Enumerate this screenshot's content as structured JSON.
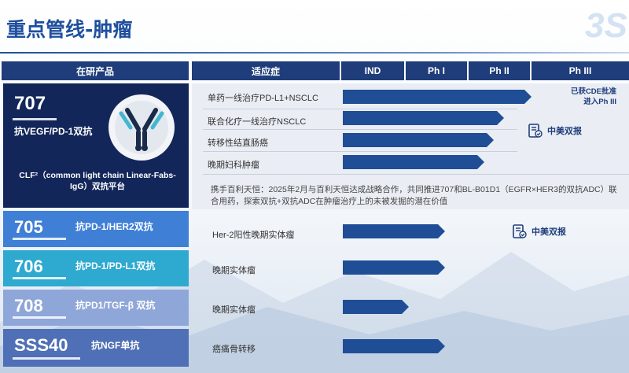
{
  "page": {
    "title": "重点管线-肿瘤",
    "logo_text": "3S"
  },
  "header": {
    "product": "在研产品",
    "indication": "适应症",
    "ind": "IND",
    "ph1": "Ph I",
    "ph2": "Ph II",
    "ph3": "Ph III"
  },
  "products": [
    {
      "code": "707",
      "desc": "抗VEGF/PD-1双抗",
      "platform": "CLF²（common light chain Linear-Fabs-IgG）双抗平台",
      "color": "#12265a",
      "indications": [
        {
          "name": "单药一线治疗PD-L1+NSCLC",
          "progress_to": "Ph III"
        },
        {
          "name": "联合化疗一线治疗NSCLC",
          "progress_to": "Ph II"
        },
        {
          "name": "转移性结直肠癌",
          "progress_to": "Ph II"
        },
        {
          "name": "晚期妇科肿瘤",
          "progress_to": "Ph II"
        }
      ],
      "cde_note_line1": "已获CDE批准",
      "cde_note_line2": "进入Ph III",
      "report_label": "中美双报",
      "note": "携手百利天恒：2025年2月与百利天恒达成战略合作，共同推进707和BL-B01D1（EGFR×HER3的双抗ADC）联合用药，探索双抗+双抗ADC在肿瘤治疗上的未被发掘的潜在价值"
    },
    {
      "code": "705",
      "desc": "抗PD-1/HER2双抗",
      "color": "#3f7fd6",
      "indications": [
        {
          "name": "Her-2阳性晚期实体瘤",
          "progress_to": "Ph I"
        }
      ],
      "report_label": "中美双报"
    },
    {
      "code": "706",
      "desc": "抗PD-1/PD-L1双抗",
      "color": "#2ea9d0",
      "indications": [
        {
          "name": "晚期实体瘤",
          "progress_to": "Ph I"
        }
      ]
    },
    {
      "code": "708",
      "desc": "抗PD1/TGF-β 双抗",
      "color": "#8fa6d8",
      "indications": [
        {
          "name": "晚期实体瘤",
          "progress_to": "IND+"
        }
      ]
    },
    {
      "code": "SSS40",
      "desc": "抗NGF单抗",
      "color": "#4f6fb6",
      "indications": [
        {
          "name": "癌痛骨转移",
          "progress_to": "Ph I"
        }
      ]
    }
  ]
}
